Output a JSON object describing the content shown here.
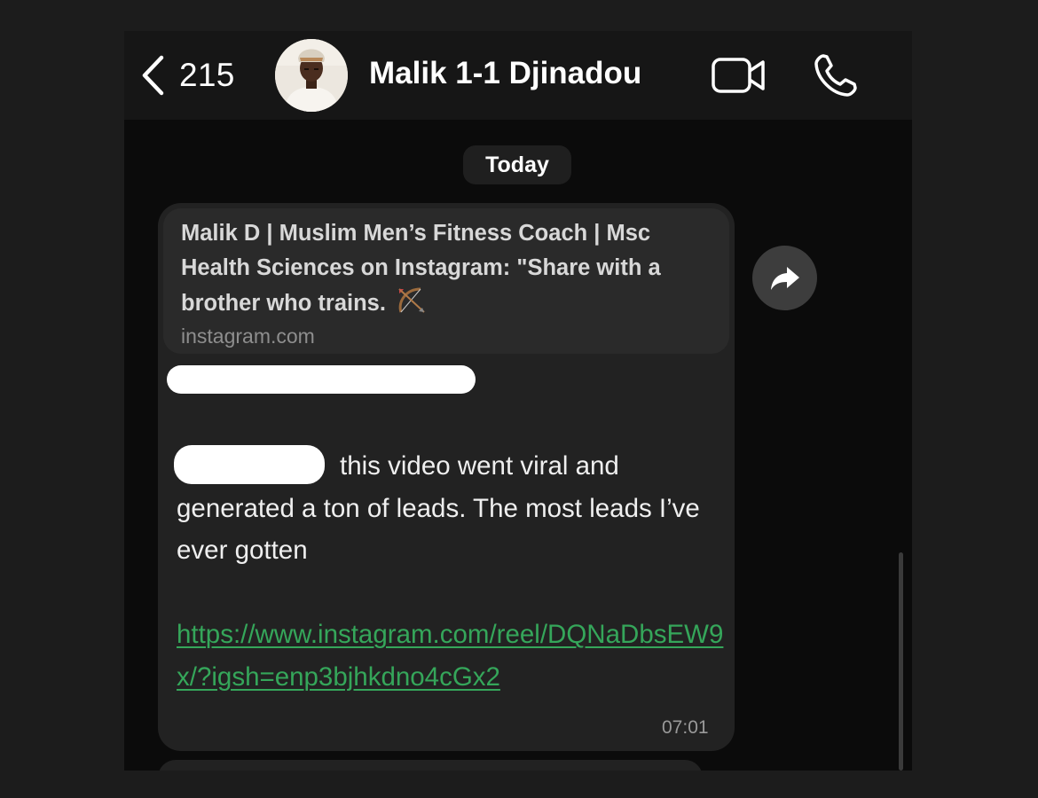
{
  "header": {
    "back_count": "215",
    "contact_name": "Malik 1-1 Djinadou",
    "avatar_icon": "person-avatar",
    "video_icon": "video-camera-icon",
    "call_icon": "phone-icon"
  },
  "conversation": {
    "date_separator": "Today",
    "message": {
      "preview": {
        "title": "Malik D | Muslim Men’s Fitness Coach |  Msc Health Sciences on Instagram: \"Share with a brother who trains.",
        "emoji": "🏹",
        "domain": "instagram.com"
      },
      "body": "this video went viral and generated a ton of leads. The most leads I’ve ever gotten",
      "link": "https://www.instagram.com/reel/DQNaDbsEW9x/?igsh=enp3bjhkdno4cGx2",
      "time": "07:01"
    },
    "forward_icon": "forward-arrow-icon"
  },
  "colors": {
    "background": "#0b0b0b",
    "bubble": "#222222",
    "preview": "#2a2a2a",
    "link": "#35a65a",
    "redaction": "#ffffff"
  }
}
